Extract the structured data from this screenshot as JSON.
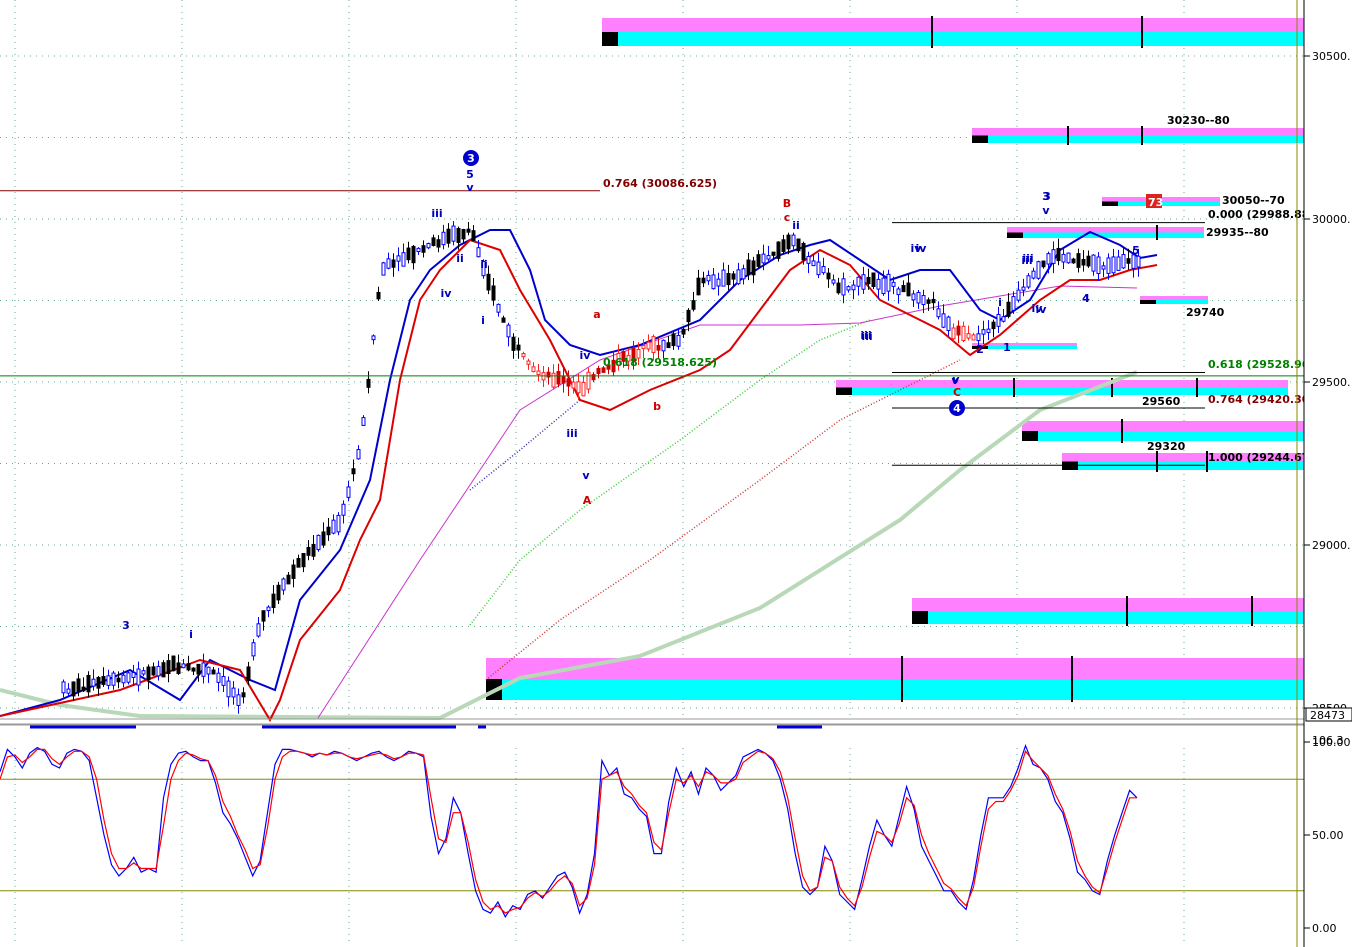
{
  "chart_data": [
    {
      "type": "candlestick",
      "panel": "price",
      "y_axis_ticks": [
        "30500.",
        "30000.",
        "29500.",
        "29000.",
        "28500"
      ],
      "y_axis_values": [
        30500,
        30000,
        29500,
        29000,
        28500
      ],
      "ylim": [
        28450,
        30700
      ],
      "last_price_label": "28473",
      "grid": true,
      "fib_labels": [
        {
          "text": "0.764 (30086.625)",
          "value": 30086.625,
          "color": "#800000"
        },
        {
          "text": "0.000 (29988.886",
          "value": 29988.886,
          "color": "#000000"
        },
        {
          "text": "0.618 (29528.96",
          "value": 29528.96,
          "color": "#008000"
        },
        {
          "text": "0.764 (29420.30",
          "value": 29420.3,
          "color": "#800000"
        },
        {
          "text": "1.000 (29244.67",
          "value": 29244.67,
          "color": "#000000"
        },
        {
          "text": "0.618 (29518.625)",
          "value": 29518.625,
          "color": "#008000"
        }
      ],
      "level_labels": [
        "30230--80",
        "30050--70",
        "29935--80",
        "29740",
        "29560",
        "29320"
      ],
      "badge": "73",
      "wave_labels_blue": [
        "3",
        "5",
        "v",
        "iii",
        "iv",
        "ii",
        "i",
        "3",
        "i",
        "iv",
        "iv",
        "iii",
        "v",
        "iii",
        "ii",
        "iii",
        "iv",
        "v",
        "iii",
        "iv",
        "3",
        "v",
        "iii",
        "iv",
        "4",
        "5",
        "i",
        "ii",
        "1",
        "2",
        "4",
        "v"
      ],
      "wave_labels_red": [
        "B",
        "c",
        "a",
        "b",
        "A",
        "C"
      ],
      "circled_labels": [
        "3",
        "4"
      ]
    },
    {
      "type": "line",
      "panel": "stochastic",
      "y_axis_ticks": [
        "100.00",
        "50.00",
        "0.00"
      ],
      "y_axis_values": [
        100,
        50,
        0
      ],
      "ylim": [
        0,
        100
      ],
      "top_label": "106.3",
      "reference_lines": [
        80,
        20
      ],
      "series": [
        {
          "color": "#0000ff",
          "values": [
            84,
            96,
            92,
            86,
            94,
            97,
            95,
            88,
            86,
            94,
            96,
            95,
            90,
            70,
            50,
            34,
            28,
            32,
            38,
            30,
            32,
            30,
            70,
            88,
            94,
            95,
            92,
            90,
            90,
            78,
            62,
            56,
            48,
            38,
            28,
            36,
            62,
            88,
            96,
            96,
            95,
            94,
            92,
            94,
            93,
            95,
            94,
            92,
            90,
            92,
            94,
            95,
            92,
            90,
            92,
            95,
            94,
            92,
            60,
            40,
            48,
            70,
            62,
            40,
            20,
            10,
            8,
            14,
            6,
            12,
            10,
            18,
            20,
            16,
            22,
            28,
            30,
            22,
            8,
            18,
            40,
            90,
            82,
            86,
            72,
            70,
            64,
            60,
            40,
            40,
            68,
            86,
            76,
            84,
            72,
            86,
            82,
            74,
            78,
            82,
            92,
            94,
            96,
            94,
            90,
            80,
            64,
            40,
            22,
            18,
            22,
            44,
            36,
            18,
            14,
            10,
            26,
            44,
            58,
            50,
            44,
            60,
            76,
            64,
            44,
            36,
            28,
            20,
            20,
            14,
            10,
            26,
            50,
            70,
            70,
            70,
            76,
            86,
            98,
            88,
            86,
            80,
            68,
            62,
            48,
            30,
            26,
            20,
            18,
            36,
            50,
            62,
            74,
            70
          ]
        },
        {
          "color": "#ff0000",
          "values": [
            80,
            92,
            93,
            89,
            92,
            96,
            96,
            91,
            88,
            92,
            95,
            95,
            92,
            80,
            58,
            40,
            32,
            32,
            35,
            32,
            32,
            32,
            55,
            80,
            90,
            94,
            93,
            91,
            90,
            82,
            68,
            60,
            50,
            42,
            32,
            34,
            54,
            80,
            92,
            95,
            95,
            94,
            93,
            94,
            93,
            94,
            94,
            92,
            91,
            92,
            93,
            94,
            93,
            91,
            92,
            94,
            94,
            93,
            70,
            48,
            46,
            62,
            62,
            46,
            26,
            14,
            10,
            12,
            8,
            10,
            11,
            16,
            19,
            17,
            20,
            25,
            28,
            24,
            12,
            16,
            34,
            80,
            82,
            84,
            76,
            72,
            66,
            62,
            46,
            42,
            62,
            80,
            78,
            82,
            76,
            84,
            82,
            78,
            78,
            80,
            89,
            92,
            95,
            94,
            91,
            84,
            70,
            48,
            28,
            20,
            22,
            38,
            36,
            22,
            16,
            12,
            22,
            38,
            52,
            50,
            46,
            56,
            70,
            66,
            50,
            40,
            32,
            24,
            21,
            16,
            12,
            22,
            44,
            64,
            68,
            68,
            74,
            82,
            95,
            90,
            86,
            82,
            72,
            64,
            52,
            36,
            28,
            22,
            19,
            32,
            46,
            58,
            70,
            70
          ]
        }
      ]
    }
  ],
  "colors": {
    "candle_up": "#0000ff",
    "candle_down": "#000000",
    "wave_red": "#cc0000",
    "band_cyan": "#00ffff",
    "band_magenta": "#ff80ff",
    "keltner_blue": "#0000cc",
    "keltner_red": "#dd0000",
    "ma_green": "#33cc33",
    "ma_brown": "#cc3333",
    "ma_grey": "#b8d8b8",
    "ma_magenta": "#cc33cc"
  }
}
